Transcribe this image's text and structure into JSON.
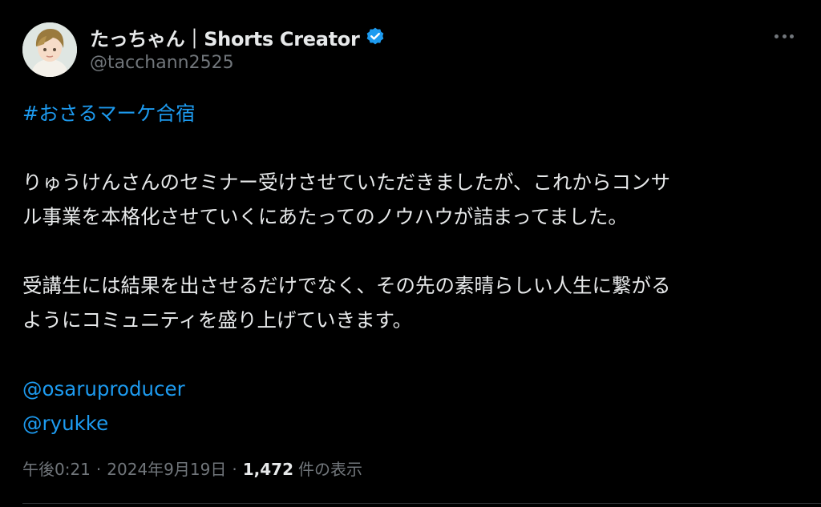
{
  "author": {
    "display_name": "たっちゃん｜Shorts Creator",
    "handle": "@tacchann2525",
    "verified_color": "#1d9bf0"
  },
  "more_icon": "more-horizontal-icon",
  "tweet": {
    "hashtag": "#おさるマーケ合宿",
    "paragraph1_line1": "りゅうけんさんのセミナー受けさせていただきましたが、これからコンサ",
    "paragraph1_line2": "ル事業を本格化させていくにあたってのノウハウが詰まってました。",
    "paragraph2_line1": "受講生には結果を出させるだけでなく、その先の素晴らしい人生に繋がる",
    "paragraph2_line2": "ようにコミュニティを盛り上げていきます。",
    "mention1": "@osaruproducer",
    "mention2": "@ryukke"
  },
  "meta": {
    "time": "午後0:21",
    "separator": "·",
    "date": "2024年9月19日",
    "views_count": "1,472",
    "views_label": "件の表示"
  },
  "colors": {
    "background": "#000000",
    "text": "#e7e9ea",
    "secondary": "#71767b",
    "link": "#1d9bf0"
  }
}
